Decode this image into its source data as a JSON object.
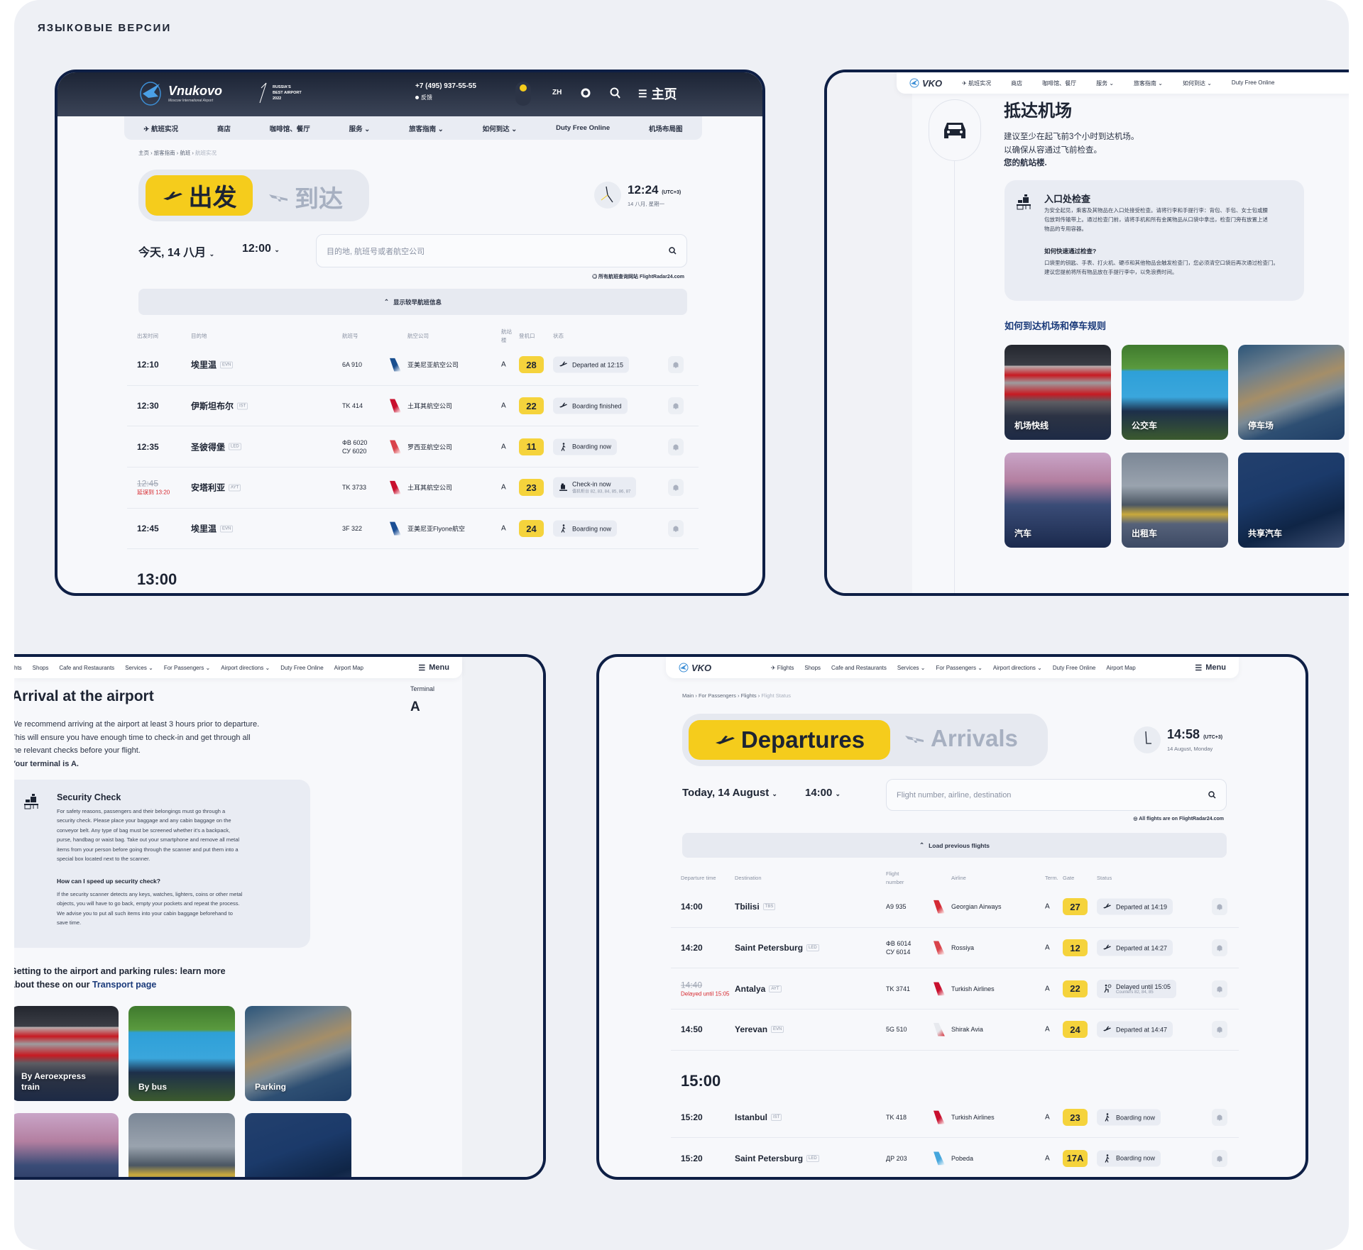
{
  "page_heading": "ЯЗЫКОВЫЕ ВЕРСИИ",
  "colors": {
    "frame": "#0e1f45",
    "accent_yellow": "#f5cc1c",
    "gate_yellow": "#f5d33c",
    "delay_red": "#d6262c",
    "link_blue": "#1a3a7a"
  },
  "zh_departures": {
    "header": {
      "logo_name": "Vnukovo",
      "logo_sub": "Moscow International Airport",
      "award_line1": "RUSSIA'S",
      "award_line2": "BEST AIRPORT",
      "award_line3": "2022",
      "phone": "+7 (495) 937-55-55",
      "feedback": "反馈",
      "lang": "ZH",
      "menu_label": "主页"
    },
    "nav": [
      {
        "label": "航班实况",
        "icon": "plane-icon"
      },
      {
        "label": "商店"
      },
      {
        "label": "咖啡馆、餐厅"
      },
      {
        "label": "服务",
        "dropdown": true
      },
      {
        "label": "旅客指南",
        "dropdown": true
      },
      {
        "label": "如何到达",
        "dropdown": true
      },
      {
        "label": "Duty Free Online"
      },
      {
        "label": "机场布局图"
      }
    ],
    "breadcrumb": [
      "主页",
      "旅客指南",
      "航班",
      "航班实况"
    ],
    "tabs": {
      "departures": "出发",
      "arrivals": "到达"
    },
    "clock": {
      "time": "12:24",
      "tz": "(UTC+3)",
      "date": "14 八月, 星期一"
    },
    "date_selector": "今天, 14 八月",
    "time_selector": "12:00",
    "search_placeholder": "目的地, 航班号或者航空公司",
    "fr24_note": "所有航班查询网站 FlightRadar24.com",
    "load_previous": "显示较早航班信息",
    "table_headers": {
      "time": "出发时间",
      "destination": "目的地",
      "flight": "航班号",
      "airline": "航空公司",
      "terminal": "航站楼",
      "gate": "登机口",
      "status": "状态"
    },
    "sections": [
      {
        "flights": [
          {
            "time": "12:10",
            "destination": "埃里温",
            "iata": "EVN",
            "flight_numbers": [
              "6A 910"
            ],
            "airline": "亚美尼亚航空公司",
            "airline_color": "#1a4f8f",
            "terminal": "A",
            "gate": "28",
            "status": "Departed at 12:15",
            "status_icon": "departed"
          },
          {
            "time": "12:30",
            "destination": "伊斯坦布尔",
            "iata": "IST",
            "flight_numbers": [
              "TK 414"
            ],
            "airline": "土耳其航空公司",
            "airline_color": "#c8102e",
            "terminal": "A",
            "gate": "22",
            "status": "Boarding finished",
            "status_icon": "departed"
          },
          {
            "time": "12:35",
            "destination": "圣彼得堡",
            "iata": "LED",
            "flight_numbers": [
              "ФВ 6020",
              "СУ 6020"
            ],
            "airline": "罗西亚航空公司",
            "airline_color": "#d9434b",
            "terminal": "A",
            "gate": "11",
            "status": "Boarding now",
            "status_icon": "boarding"
          },
          {
            "time_old": "12:45",
            "delay_note": "延误到 13:20",
            "destination": "安塔利亚",
            "iata": "AYT",
            "flight_numbers": [
              "TK 3733"
            ],
            "airline": "土耳其航空公司",
            "airline_color": "#c8102e",
            "terminal": "A",
            "gate": "23",
            "status": "Check-in now",
            "status_sub": "值机柜台 82, 83, 84, 85, 86, 87",
            "status_icon": "checkin"
          },
          {
            "time": "12:45",
            "destination": "埃里温",
            "iata": "EVN",
            "flight_numbers": [
              "3F 322"
            ],
            "airline": "亚美尼亚Flyone航空",
            "airline_color": "#1b4f95",
            "terminal": "A",
            "gate": "24",
            "status": "Boarding now",
            "status_icon": "boarding"
          }
        ]
      },
      {
        "hour": "13:00",
        "flights": []
      }
    ]
  },
  "zh_arrival": {
    "logo": "VKO",
    "nav": [
      {
        "label": "航班实况",
        "icon": "plane-icon"
      },
      {
        "label": "商店"
      },
      {
        "label": "咖啡馆、餐厅"
      },
      {
        "label": "服务",
        "dropdown": true
      },
      {
        "label": "旅客指南",
        "dropdown": true
      },
      {
        "label": "如何到达",
        "dropdown": true
      },
      {
        "label": "Duty Free Online"
      }
    ],
    "title": "抵达机场",
    "intro": [
      "建议至少在起飞前3个小时到达机场。",
      "以确保从容通过飞前检查。"
    ],
    "terminal_line": "您的航站楼.",
    "card_title": "入口处检查",
    "card_body": "为安全起见，乘客及其物品在入口处接受检查。请将行李和手提行李：背包、手包、女士包或腰包放到传输带上。通过检查门前，请将手机和所有金属物品从口袋中拿出，检查门旁有放置上述物品的专用容器。",
    "card_subtitle": "如何快速通过检查?",
    "card_body2": "口袋里的钥匙、手表、打火机、硬币和其他物品会触发检查门，您必须清空口袋后再次通过检查门。建议您提前将所有物品放在手提行李中，以免浪费时间。",
    "transport_heading": "如何到达机场和停车规则",
    "tiles": [
      "机场快线",
      "公交车",
      "停车场",
      "汽车",
      "出租车",
      "共享汽车"
    ]
  },
  "en_arrival": {
    "nav": [
      {
        "label": "hts"
      },
      {
        "label": "Shops"
      },
      {
        "label": "Cafe and Restaurants"
      },
      {
        "label": "Services",
        "dropdown": true
      },
      {
        "label": "For Passengers",
        "dropdown": true
      },
      {
        "label": "Airport directions",
        "dropdown": true
      },
      {
        "label": "Duty Free Online"
      },
      {
        "label": "Airport Map"
      }
    ],
    "menu_label": "Menu",
    "title": "Arrival at the airport",
    "terminal_label": "Terminal",
    "terminal_value": "A",
    "intro": [
      "We recommend arriving at the airport at least 3 hours prior to departure.",
      "This will ensure you have enough time to check-in and get through all",
      "the relevant checks before your flight."
    ],
    "terminal_line": "Your terminal is A.",
    "card_title": "Security Check",
    "card_body": "For safety reasons, passengers and their belongings must go through a security check. Please place your baggage and any cabin baggage on the conveyor belt. Any type of bag must be screened whether it's a backpack, purse, handbag or waist bag. Take out your smartphone and remove all metal items from your person before going through the scanner and put them into a special box located next to the scanner.",
    "card_subtitle": "How can I speed up security check?",
    "card_body2": "If the security scanner detects any keys, watches, lighters, coins or other metal objects, you will have to go back, empty your pockets and repeat the process. We advise you to put all such items into your cabin baggage beforehand to save time.",
    "transport_heading": "Getting to the airport and parking rules: learn more about these on our ",
    "transport_link": "Transport page",
    "tiles": [
      "By Aeroexpress train",
      "By bus",
      "Parking",
      "",
      "",
      ""
    ]
  },
  "en_departures": {
    "logo": "VKO",
    "nav": [
      {
        "label": "Flights",
        "icon": "plane-icon"
      },
      {
        "label": "Shops"
      },
      {
        "label": "Cafe and Restaurants"
      },
      {
        "label": "Services",
        "dropdown": true
      },
      {
        "label": "For Passengers",
        "dropdown": true
      },
      {
        "label": "Airport directions",
        "dropdown": true
      },
      {
        "label": "Duty Free Online"
      },
      {
        "label": "Airport Map"
      }
    ],
    "menu_label": "Menu",
    "breadcrumb": [
      "Main",
      "For Passengers",
      "Flights",
      "Flight Status"
    ],
    "tabs": {
      "departures": "Departures",
      "arrivals": "Arrivals"
    },
    "clock": {
      "time": "14:58",
      "tz": "(UTC+3)",
      "date": "14 August, Monday"
    },
    "date_selector": "Today, 14 August",
    "time_selector": "14:00",
    "search_placeholder": "Flight number, airline, destination",
    "fr24_note": "All flights are on FlightRadar24.com",
    "load_previous": "Load previous flights",
    "table_headers": {
      "time": "Departure time",
      "destination": "Destination",
      "flight": "Flight number",
      "airline": "Airline",
      "terminal": "Term.",
      "gate": "Gate",
      "status": "Status"
    },
    "sections": [
      {
        "flights": [
          {
            "time": "14:00",
            "destination": "Tbilisi",
            "iata": "TBS",
            "flight_numbers": [
              "A9 935"
            ],
            "airline": "Georgian Airways",
            "airline_color": "#d42a34",
            "terminal": "A",
            "gate": "27",
            "status": "Departed at 14:19",
            "status_icon": "departed"
          },
          {
            "time": "14:20",
            "destination": "Saint Petersburg",
            "iata": "LED",
            "flight_numbers": [
              "ФВ 6014",
              "СУ 6014"
            ],
            "airline": "Rossiya",
            "airline_color": "#d9434b",
            "terminal": "A",
            "gate": "12",
            "status": "Departed at 14:27",
            "status_icon": "departed"
          },
          {
            "time_old": "14:40",
            "delay_note": "Delayed until 15:05",
            "destination": "Antalya",
            "iata": "AYT",
            "flight_numbers": [
              "TK 3741"
            ],
            "airline": "Turkish Airlines",
            "airline_color": "#c8102e",
            "terminal": "A",
            "gate": "22",
            "status": "Delayed until 15:05",
            "status_sub": "Counters 82, 84, 85",
            "status_icon": "delayed"
          },
          {
            "time": "14:50",
            "destination": "Yerevan",
            "iata": "EVN",
            "flight_numbers": [
              "5G 510"
            ],
            "airline": "Shirak Avia",
            "airline_color": "#e7e9ee",
            "terminal": "A",
            "gate": "24",
            "status": "Departed at 14:47",
            "status_icon": "departed"
          }
        ]
      },
      {
        "hour": "15:00",
        "flights": [
          {
            "time": "15:20",
            "destination": "Istanbul",
            "iata": "IST",
            "flight_numbers": [
              "TK 418"
            ],
            "airline": "Turkish Airlines",
            "airline_color": "#c8102e",
            "terminal": "A",
            "gate": "23",
            "status": "Boarding now",
            "status_icon": "boarding"
          },
          {
            "time": "15:20",
            "destination": "Saint Petersburg",
            "iata": "LED",
            "flight_numbers": [
              "ДР 203"
            ],
            "airline": "Pobeda",
            "airline_color": "#45a6dc",
            "terminal": "A",
            "gate": "17A",
            "status": "Boarding now",
            "status_icon": "boarding"
          }
        ]
      }
    ]
  }
}
